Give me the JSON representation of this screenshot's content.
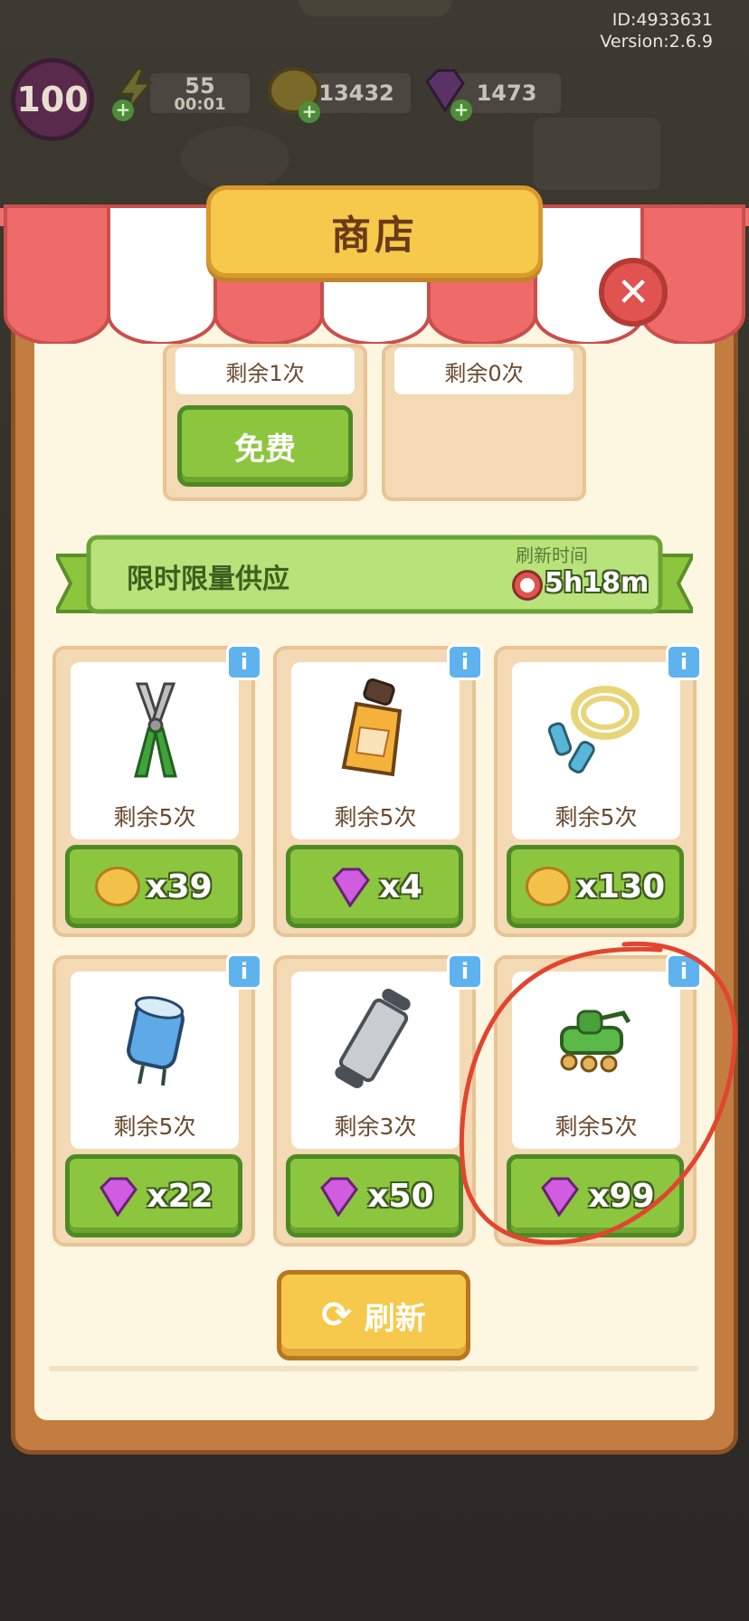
{
  "meta": {
    "id": "ID:4933631",
    "version": "Version:2.6.9"
  },
  "player": {
    "level": "100"
  },
  "resources": {
    "energy": {
      "value": "55",
      "timer": "00:01"
    },
    "coins": {
      "value": "13432"
    },
    "gems": {
      "value": "1473"
    }
  },
  "shop": {
    "title": "商店",
    "close_icon": "close-icon",
    "top_cards": [
      {
        "remaining": "剩余1次",
        "button": "免费"
      },
      {
        "remaining": "剩余0次"
      }
    ],
    "limited": {
      "title": "限时限量供应",
      "refresh_label": "刷新时间",
      "refresh_time": "5h18m"
    },
    "items": [
      {
        "name": "pliers",
        "remaining": "剩余5次",
        "currency": "coin",
        "price": "x39"
      },
      {
        "name": "bottle",
        "remaining": "剩余5次",
        "currency": "gem",
        "price": "x4"
      },
      {
        "name": "jump-rope",
        "remaining": "剩余5次",
        "currency": "coin",
        "price": "x130"
      },
      {
        "name": "capacitor",
        "remaining": "剩余5次",
        "currency": "gem",
        "price": "x22"
      },
      {
        "name": "roller",
        "remaining": "剩余3次",
        "currency": "gem",
        "price": "x50"
      },
      {
        "name": "tank-toy",
        "remaining": "剩余5次",
        "currency": "gem",
        "price": "x99"
      }
    ],
    "info_label": "i",
    "refresh_button": "刷新"
  },
  "colors": {
    "accent_green": "#8cc63e",
    "gold": "#f6c94c",
    "annotation": "#e2452f"
  }
}
